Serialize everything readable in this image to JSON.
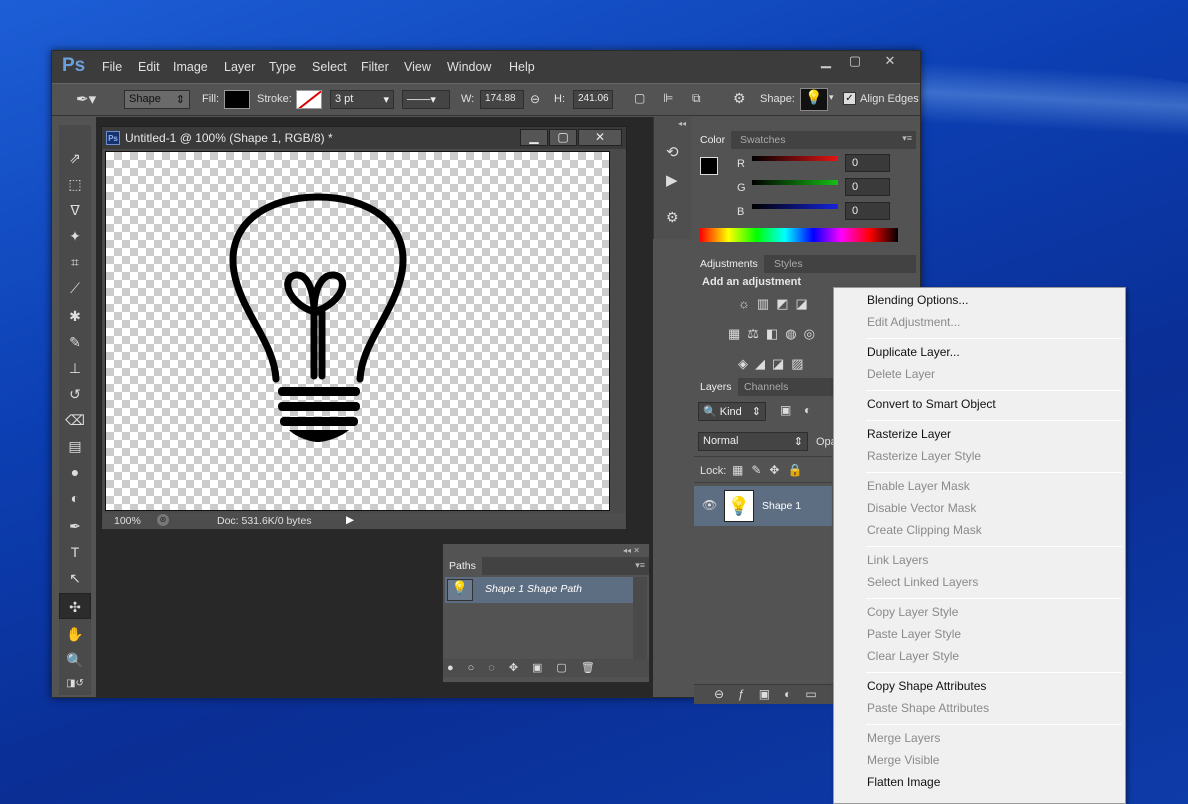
{
  "app": {
    "logo": "Ps",
    "menus": [
      "File",
      "Edit",
      "Image",
      "Layer",
      "Type",
      "Select",
      "Filter",
      "View",
      "Window",
      "Help"
    ]
  },
  "options": {
    "mode": "Shape",
    "fill_label": "Fill:",
    "stroke_label": "Stroke:",
    "stroke_size": "3 pt",
    "w_label": "W:",
    "w_value": "174.88",
    "h_label": "H:",
    "h_value": "241.06",
    "shape_label": "Shape:",
    "align_edges": "Align Edges"
  },
  "document": {
    "title": "Untitled-1 @ 100% (Shape 1, RGB/8) *",
    "zoom": "100%",
    "doc_info": "Doc: 531.6K/0 bytes"
  },
  "color_panel": {
    "tabs": [
      "Color",
      "Swatches"
    ],
    "r_label": "R",
    "g_label": "G",
    "b_label": "B",
    "r": "0",
    "g": "0",
    "b": "0",
    "colors": {
      "r": "#d01010",
      "g": "#10b010",
      "b": "#1020d0"
    }
  },
  "adjustments": {
    "tabs": [
      "Adjustments",
      "Styles"
    ],
    "heading": "Add an adjustment"
  },
  "layers": {
    "tabs": [
      "Layers",
      "Channels"
    ],
    "kind": "Kind",
    "blend": "Normal",
    "opacity_label": "Opa",
    "lock_label": "Lock:",
    "layer_name": "Shape 1"
  },
  "paths": {
    "tab": "Paths",
    "path_name": "Shape 1 Shape Path"
  },
  "context_menu": {
    "items": [
      {
        "label": "Blending Options...",
        "enabled": true
      },
      {
        "label": "Edit Adjustment...",
        "enabled": false
      },
      {
        "label": "Duplicate Layer...",
        "enabled": true
      },
      {
        "label": "Delete Layer",
        "enabled": false
      },
      {
        "label": "Convert to Smart Object",
        "enabled": true
      },
      {
        "label": "Rasterize Layer",
        "enabled": true
      },
      {
        "label": "Rasterize Layer Style",
        "enabled": false
      },
      {
        "label": "Enable Layer Mask",
        "enabled": false
      },
      {
        "label": "Disable Vector Mask",
        "enabled": false
      },
      {
        "label": "Create Clipping Mask",
        "enabled": false
      },
      {
        "label": "Link Layers",
        "enabled": false
      },
      {
        "label": "Select Linked Layers",
        "enabled": false
      },
      {
        "label": "Copy Layer Style",
        "enabled": false
      },
      {
        "label": "Paste Layer Style",
        "enabled": false
      },
      {
        "label": "Clear Layer Style",
        "enabled": false
      },
      {
        "label": "Copy Shape Attributes",
        "enabled": true
      },
      {
        "label": "Paste Shape Attributes",
        "enabled": false
      },
      {
        "label": "Merge Layers",
        "enabled": false
      },
      {
        "label": "Merge Visible",
        "enabled": false
      },
      {
        "label": "Flatten Image",
        "enabled": true
      }
    ]
  }
}
